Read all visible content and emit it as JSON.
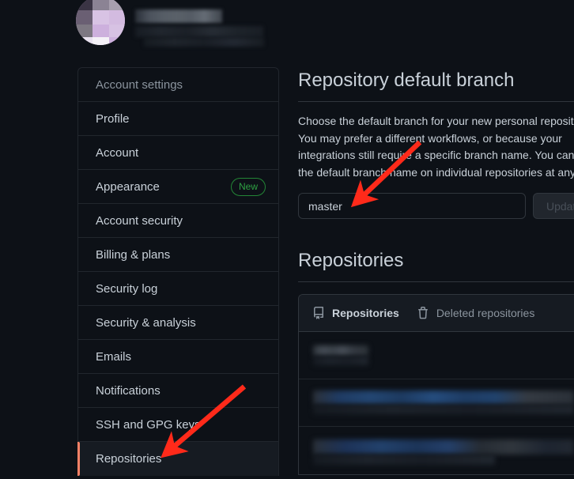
{
  "theme": {
    "background": "#0d1117",
    "surface": "#161b22",
    "border": "#30363d",
    "text": "#c9d1d9",
    "muted": "#8b949e",
    "accent_active": "#f78166",
    "link": "#58a6ff",
    "badge_green": "#2ea043",
    "annotation_red": "#ff2a1a"
  },
  "header": {
    "avatar_alt": "user avatar (blurred)",
    "username_redacted": "",
    "subtitle_redacted": ""
  },
  "sidebar": {
    "heading": "Account settings",
    "items": [
      {
        "label": "Profile",
        "badge": "",
        "active": false
      },
      {
        "label": "Account",
        "badge": "",
        "active": false
      },
      {
        "label": "Appearance",
        "badge": "New",
        "active": false
      },
      {
        "label": "Account security",
        "badge": "",
        "active": false
      },
      {
        "label": "Billing & plans",
        "badge": "",
        "active": false
      },
      {
        "label": "Security log",
        "badge": "",
        "active": false
      },
      {
        "label": "Security & analysis",
        "badge": "",
        "active": false
      },
      {
        "label": "Emails",
        "badge": "",
        "active": false
      },
      {
        "label": "Notifications",
        "badge": "",
        "active": false
      },
      {
        "label": "SSH and GPG keys",
        "badge": "",
        "active": false
      },
      {
        "label": "Repositories",
        "badge": "",
        "active": true
      }
    ]
  },
  "main": {
    "default_branch": {
      "title": "Repository default branch",
      "description": "Choose the default branch for your new personal repositories. You may prefer a different workflows, or because your integrations still require a specific branch name. You can change the default branch name on individual repositories at any time.",
      "input_value": "master",
      "input_placeholder": "master",
      "update_label": "Update"
    },
    "repositories": {
      "title": "Repositories",
      "tabs": [
        {
          "label": "Repositories",
          "icon": "repo-icon",
          "selected": true
        },
        {
          "label": "Deleted repositories",
          "icon": "trash-icon",
          "selected": false
        }
      ],
      "rows": [
        {
          "redacted": true
        },
        {
          "redacted": true
        },
        {
          "redacted": true
        }
      ]
    }
  },
  "annotations": {
    "arrow_1_target": "master branch name input",
    "arrow_2_target": "Repositories sidebar item"
  }
}
